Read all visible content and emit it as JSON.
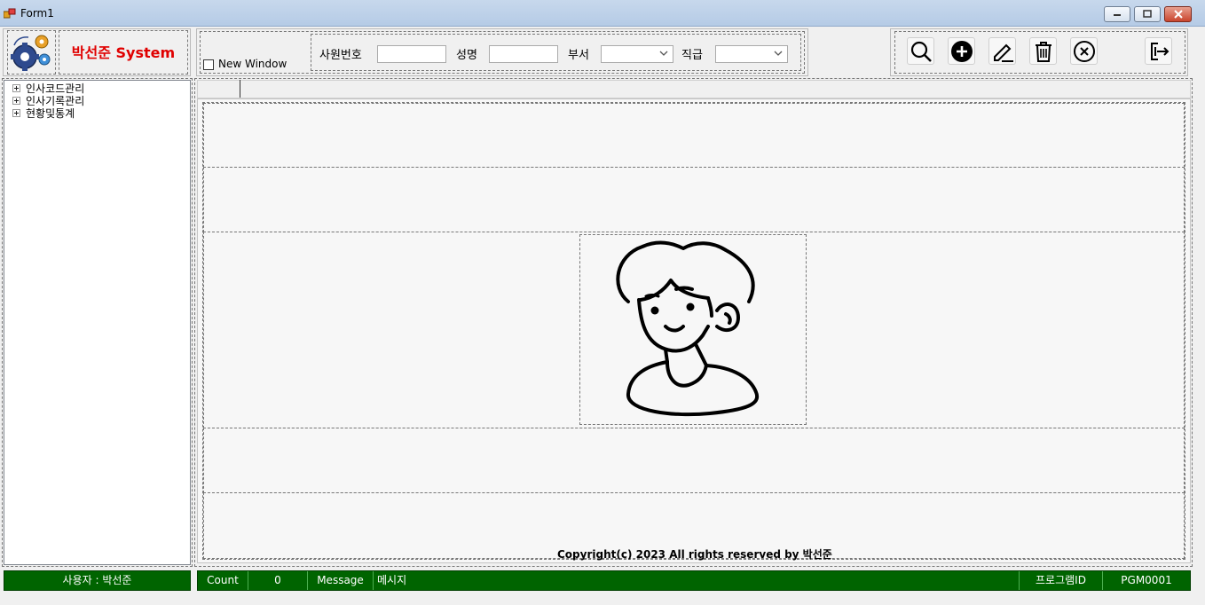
{
  "window": {
    "title": "Form1"
  },
  "header": {
    "system_title": "박선준 System"
  },
  "search": {
    "new_window_label": "New Window",
    "emp_no_label": "사원번호",
    "name_label": "성명",
    "dept_label": "부서",
    "rank_label": "직급"
  },
  "toolbar": {
    "search_icon": "magnifier-icon",
    "add_icon": "plus-circle-icon",
    "edit_icon": "pencil-icon",
    "delete_icon": "trash-icon",
    "cancel_icon": "x-circle-icon",
    "exit_icon": "exit-door-icon"
  },
  "tree": {
    "items": [
      {
        "label": "인사코드관리"
      },
      {
        "label": "인사기록관리"
      },
      {
        "label": "현황및통계"
      }
    ]
  },
  "main": {
    "copyright": "Copyright(c) 2023 All rights reserved by 박선준"
  },
  "status": {
    "user_label": "사용자 : 박선준",
    "count_label": "Count",
    "count_value": "0",
    "message_label": "Message",
    "message_value": "메시지",
    "program_id_label": "프로그램ID",
    "program_id_value": "PGM0001"
  }
}
